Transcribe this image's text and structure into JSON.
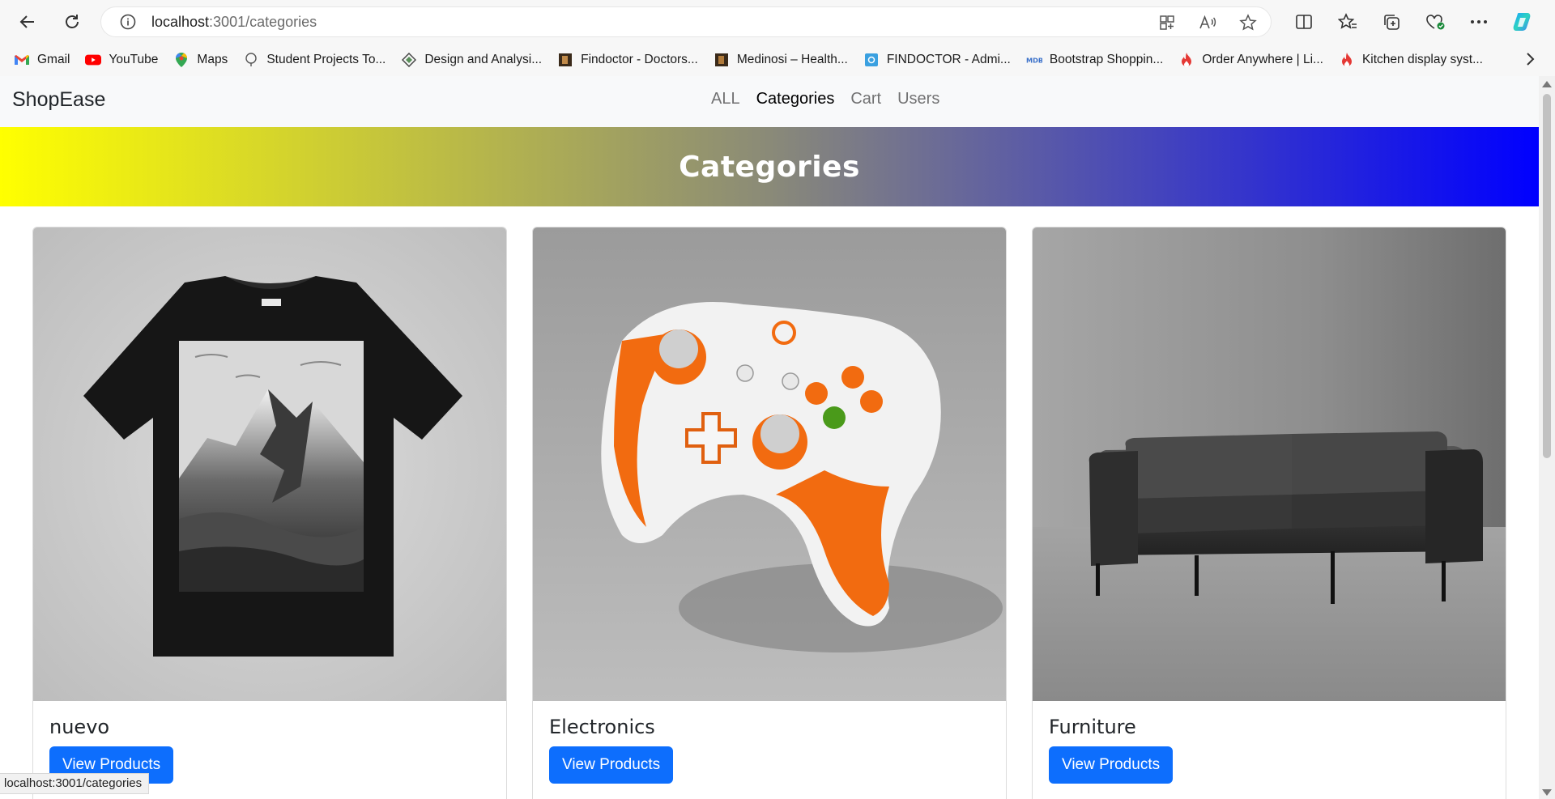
{
  "browser": {
    "url_host": "localhost",
    "url_rest": ":3001/categories",
    "bookmarks": [
      {
        "label": "Gmail",
        "icon": "gmail-icon"
      },
      {
        "label": "YouTube",
        "icon": "youtube-icon"
      },
      {
        "label": "Maps",
        "icon": "maps-icon"
      },
      {
        "label": "Student Projects To...",
        "icon": "globe-icon"
      },
      {
        "label": "Design and Analysi...",
        "icon": "diamond-icon"
      },
      {
        "label": "Findoctor - Doctors...",
        "icon": "site-icon"
      },
      {
        "label": "Medinosi – Health...",
        "icon": "site-icon"
      },
      {
        "label": "FINDOCTOR - Admi...",
        "icon": "gear-site-icon"
      },
      {
        "label": "Bootstrap Shoppin...",
        "icon": "mdb-icon"
      },
      {
        "label": "Order Anywhere | Li...",
        "icon": "flame-icon"
      },
      {
        "label": "Kitchen display syst...",
        "icon": "flame-icon"
      }
    ],
    "status_url": "localhost:3001/categories"
  },
  "navbar": {
    "brand": "ShopEase",
    "links": [
      {
        "label": "ALL",
        "active": false
      },
      {
        "label": "Categories",
        "active": true
      },
      {
        "label": "Cart",
        "active": false
      },
      {
        "label": "Users",
        "active": false
      }
    ]
  },
  "hero": {
    "title": "Categories",
    "gradient_start": "#ffff00",
    "gradient_end": "#0000ff"
  },
  "categories": [
    {
      "title": "nuevo",
      "button": "View Products",
      "image": "black-tshirt-mountain-print"
    },
    {
      "title": "Electronics",
      "button": "View Products",
      "image": "orange-white-game-controller"
    },
    {
      "title": "Furniture",
      "button": "View Products",
      "image": "black-leather-sofa"
    }
  ],
  "colors": {
    "primary_button": "#0d6efd",
    "navbar_bg": "#f8f9fa"
  }
}
